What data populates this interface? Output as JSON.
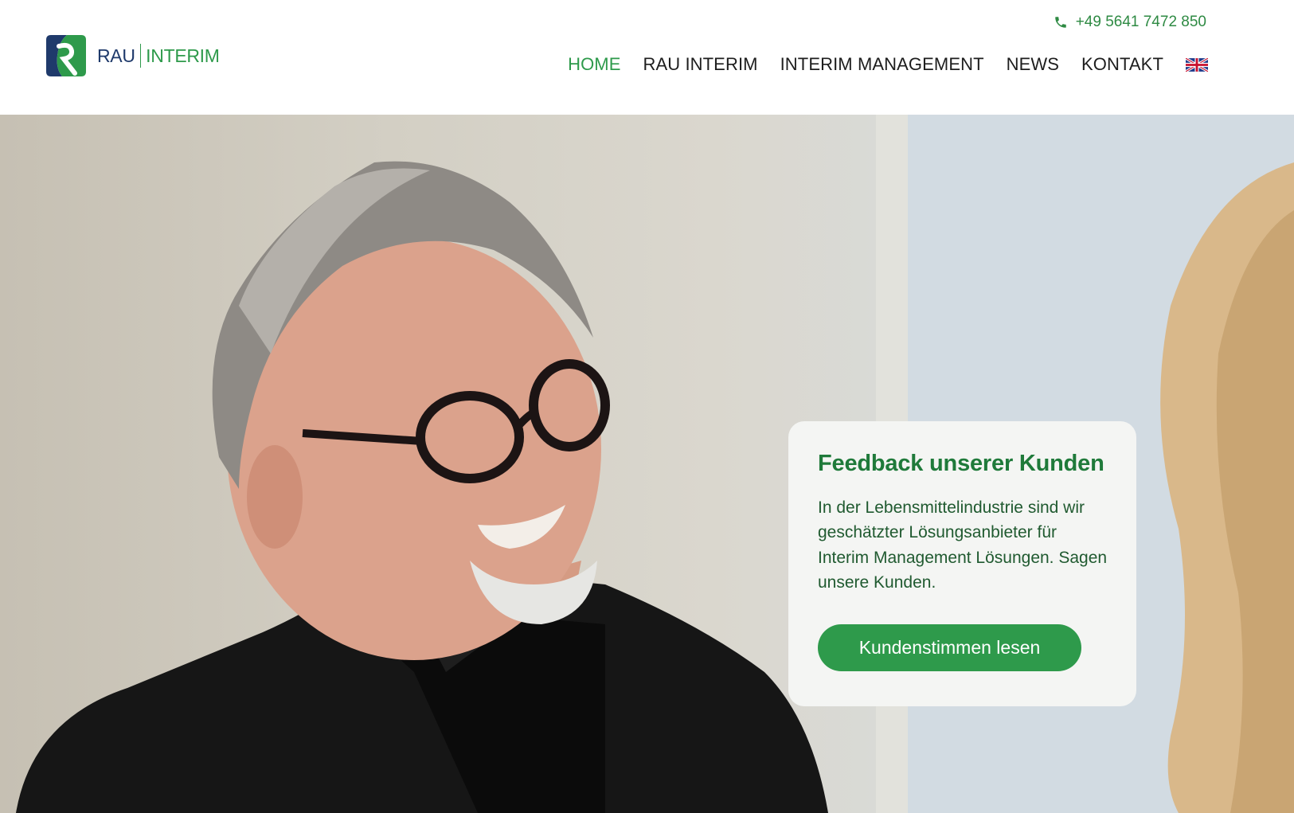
{
  "brand": {
    "name_part1": "RAU",
    "name_part2": "INTERIM",
    "primary_color": "#2e9a4b",
    "secondary_color": "#1f3a6b"
  },
  "header": {
    "phone": "+49 5641 7472 850",
    "phone_icon": "phone-icon",
    "nav": [
      {
        "label": "HOME",
        "active": true
      },
      {
        "label": "RAU INTERIM",
        "active": false
      },
      {
        "label": "INTERIM MANAGEMENT",
        "active": false
      },
      {
        "label": "NEWS",
        "active": false
      },
      {
        "label": "KONTAKT",
        "active": false
      }
    ],
    "language_icon": "uk-flag-icon"
  },
  "hero": {
    "card": {
      "title": "Feedback unserer Kunden",
      "text": "In der Lebensmittelindustrie sind wir geschätzter Lösungsanbieter für Interim Management Lösungen. Sagen unsere Kunden.",
      "button": "Kundenstimmen lesen"
    }
  }
}
